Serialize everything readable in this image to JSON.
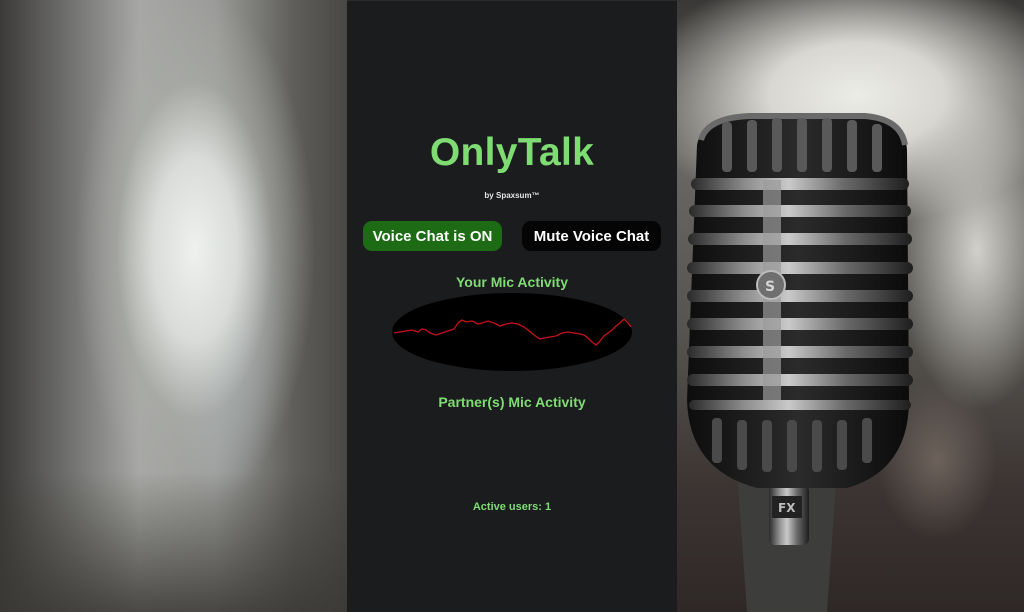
{
  "app": {
    "title": "OnlyTalk",
    "byline": "by Spaxsum™"
  },
  "controls": {
    "voice_chat_label": "Voice Chat is ON",
    "mute_label": "Mute Voice Chat"
  },
  "activity": {
    "my_mic_label": "Your Mic Activity",
    "partner_mic_label": "Partner(s) Mic Activity"
  },
  "status": {
    "active_users": "Active users: 1"
  },
  "colors": {
    "accent_green": "#7fdc73",
    "button_on": "#1d6b14",
    "button_mute": "#050505",
    "panel": "#1b1c1e",
    "waveform": "#c8101a"
  }
}
